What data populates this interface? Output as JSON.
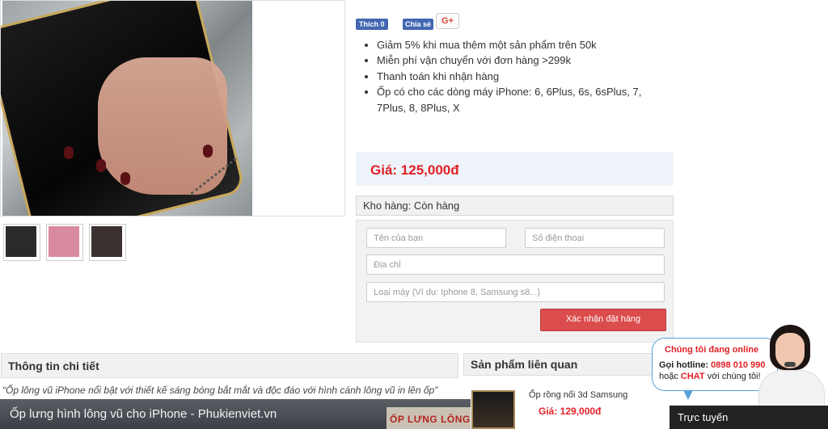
{
  "gallery": {
    "thumbnail_colors": [
      "#2a2a2a",
      "#d98aa0",
      "#3b3030"
    ]
  },
  "social": {
    "like_label": "Thích 0",
    "share_label": "Chia sẻ",
    "gplus_label": "G+"
  },
  "features": [
    "Giảm 5% khi mua thêm một sản phẩm trên 50k",
    "Miễn phí vận chuyển với đơn hàng >299k",
    "Thanh toán khi nhận hàng",
    "Ốp có cho các dòng máy iPhone: 6, 6Plus, 6s, 6sPlus, 7, 7Plus, 8, 8Plus, X"
  ],
  "price": {
    "label": "Giá: 125,000đ"
  },
  "stock": {
    "label": "Kho hàng: Còn hàng"
  },
  "order_form": {
    "name_placeholder": "Tên của bạn",
    "phone_placeholder": "Số điện thoại",
    "address_placeholder": "Địa chỉ",
    "model_placeholder": "Loại máy (Ví dụ: Iphone 8, Samsung s8...)",
    "submit_label": "Xác nhận đặt hàng"
  },
  "details": {
    "heading": "Thông tin chi tiết",
    "text": "“Ốp lông vũ iPhone nổi bật với thiết kế sáng bóng bắt mắt và độc đáo với hình cánh lông vũ in lên ốp”"
  },
  "video": {
    "title": "Ốp lưng hình lông vũ cho iPhone - Phukienviet.vn",
    "thumb_text": "ỐP LƯNG LÔNG"
  },
  "related": {
    "heading": "Sản phẩm liên quan",
    "items": [
      {
        "name": "Ốp rồng nổi 3d Samsung",
        "price": "Giá: 129,000đ"
      }
    ]
  },
  "support": {
    "online_label": "Chúng tôi đang online",
    "hotline_prefix": "Gọi hotline: ",
    "hotline_number": "0898 010 990",
    "chat_prefix": "hoặc ",
    "chat_word": "CHAT",
    "chat_suffix": " với chúng tôi!",
    "bar_label": "Trực tuyến"
  },
  "colors": {
    "price_red": "#e21f26",
    "submit_red": "#db4c4c",
    "facebook_blue": "#4267b2"
  }
}
